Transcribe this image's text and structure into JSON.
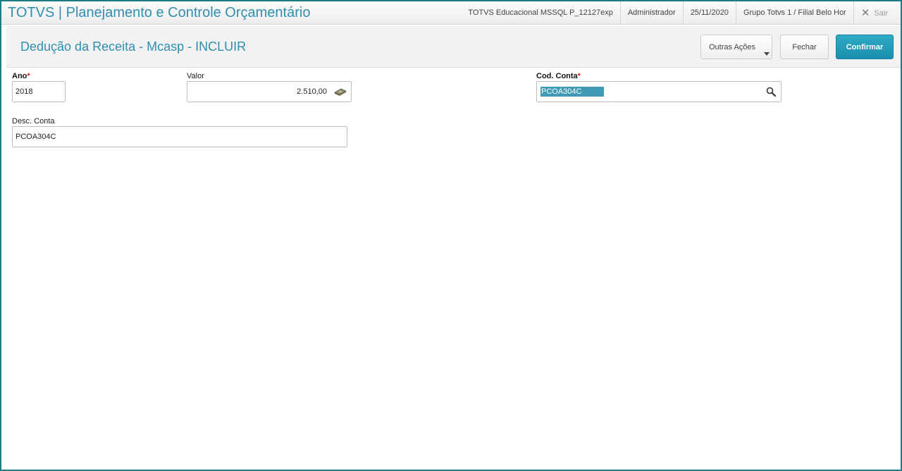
{
  "app": {
    "title": "TOTVS | Planejamento e Controle Orçamentário"
  },
  "topbar": {
    "environment": "TOTVS Educacional MSSQL P_12127exp",
    "user": "Administrador",
    "date": "25/11/2020",
    "branch": "Grupo Totvs 1 / Filial Belo Hor",
    "exit_label": "Sair"
  },
  "header": {
    "title": "Dedução da Receita - Mcasp - INCLUIR",
    "more_actions_label": "Outras Ações",
    "close_label": "Fechar",
    "confirm_label": "Confirmar"
  },
  "form": {
    "ano": {
      "label": "Ano",
      "required_mark": "*",
      "value": "2018"
    },
    "valor": {
      "label": "Valor",
      "value": "2.510,00"
    },
    "cod_conta": {
      "label": "Cod. Conta",
      "required_mark": "*",
      "value": "PCOA304C"
    },
    "desc_conta": {
      "label": "Desc. Conta",
      "value": "PCOA304C"
    }
  },
  "colors": {
    "accent": "#2e8fb0",
    "confirm_button": "#1a8fab",
    "selection": "#3f9bb5",
    "required": "#e02020",
    "window_border": "#1b7c8a"
  },
  "icons": {
    "exit": "close-icon",
    "more_actions": "chevron-down-icon",
    "valor": "money-icon",
    "cod_conta": "search-icon"
  }
}
